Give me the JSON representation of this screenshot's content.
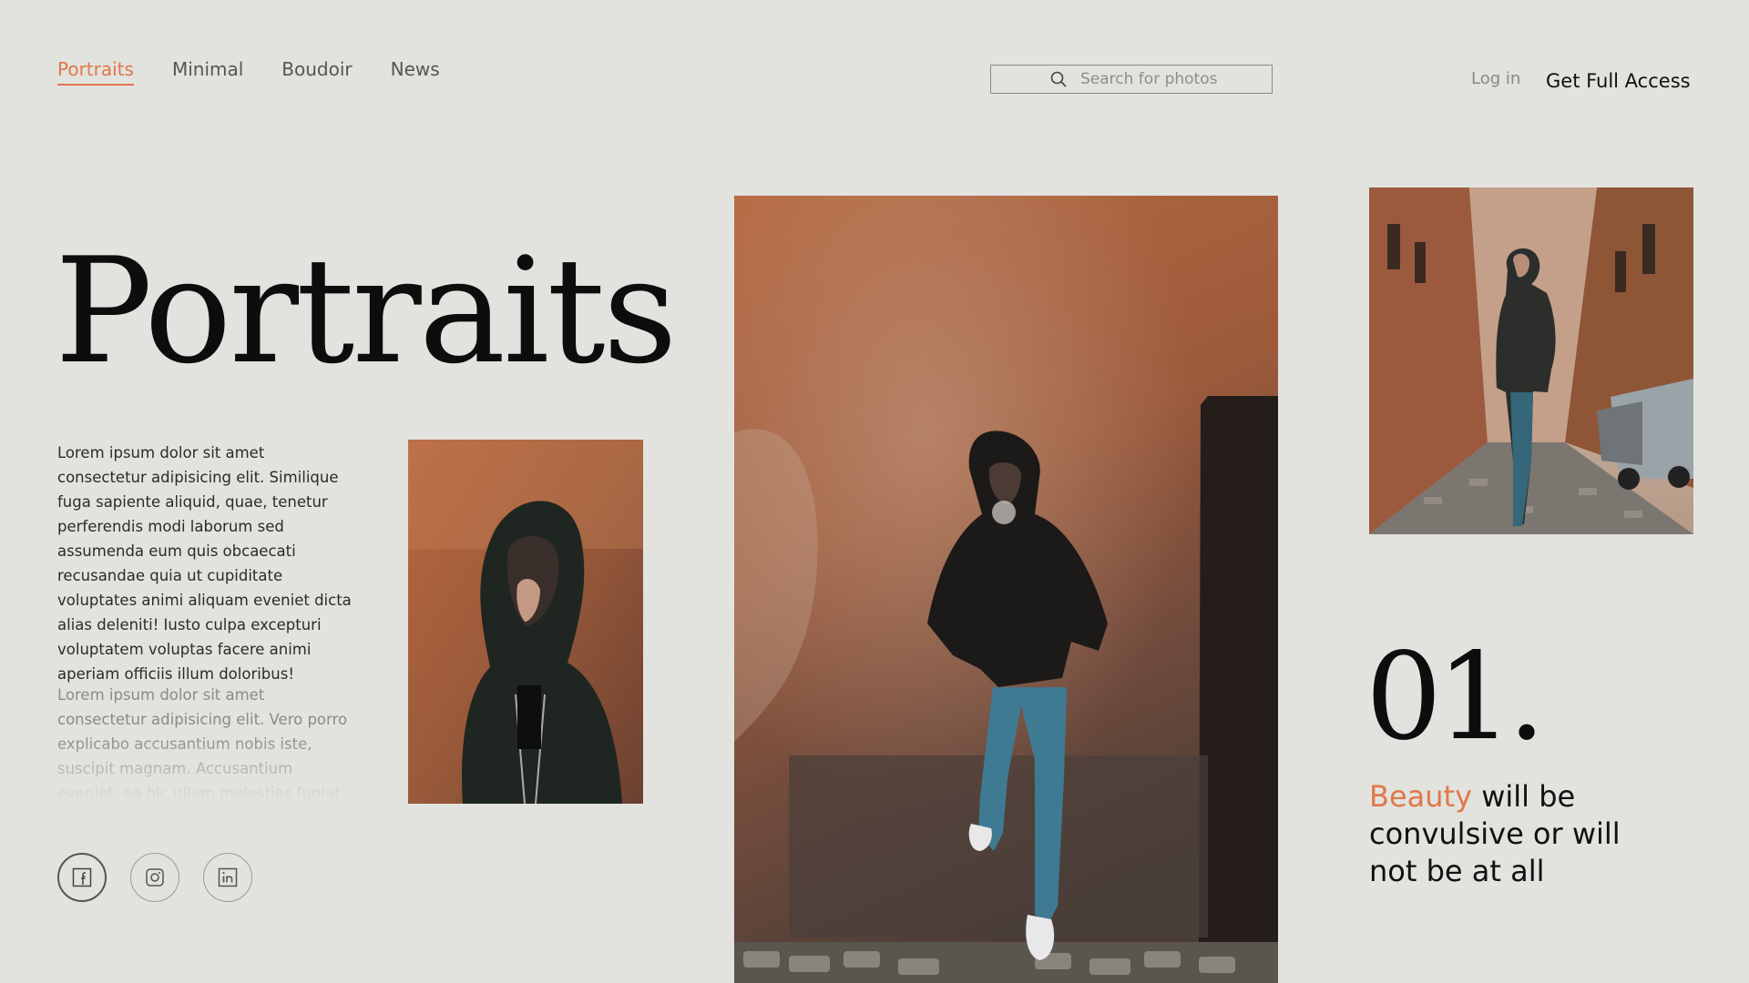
{
  "nav": {
    "items": [
      {
        "label": "Portraits",
        "active": true
      },
      {
        "label": "Minimal",
        "active": false
      },
      {
        "label": "Boudoir",
        "active": false
      },
      {
        "label": "News",
        "active": false
      }
    ]
  },
  "search": {
    "placeholder": "Search for photos",
    "value": ""
  },
  "header": {
    "login_label": "Log in",
    "cta_label": "Get Full Access"
  },
  "hero": {
    "title": "Portraits",
    "paragraph_1": "Lorem ipsum dolor sit amet consectetur adipisicing elit. Similique fuga sapiente aliquid, quae, tenetur perferendis modi laborum sed assumenda eum quis obcaecati recusandae quia ut cupiditate voluptates animi aliquam eveniet dicta alias deleniti! Iusto culpa excepturi voluptatem voluptas facere animi aperiam officiis illum doloribus!",
    "paragraph_2": "Lorem ipsum dolor sit amet consectetur adipisicing elit. Vero porro explicabo accusantium nobis iste, suscipit magnam. Accusantium eveniet, ea hic ullam molestias fugiat autem"
  },
  "social": [
    {
      "icon": "facebook-icon"
    },
    {
      "icon": "instagram-icon"
    },
    {
      "icon": "linkedin-icon"
    }
  ],
  "feature": {
    "number": "01.",
    "quote_accent": "Beauty",
    "quote_rest": " will be convulsive or will not be at all"
  },
  "colors": {
    "background": "#e2e2de",
    "accent": "#e0784a",
    "text": "#1a1a1a"
  }
}
